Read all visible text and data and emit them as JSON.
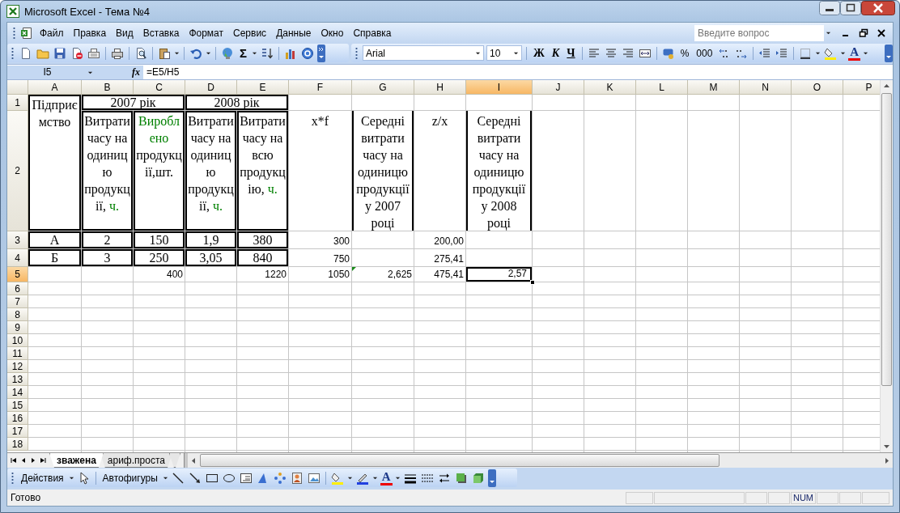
{
  "window": {
    "title": "Microsoft Excel - Тема №4"
  },
  "menu": [
    "Файл",
    "Правка",
    "Вид",
    "Вставка",
    "Формат",
    "Сервис",
    "Данные",
    "Окно",
    "Справка"
  ],
  "help_search": {
    "placeholder": "Введите вопрос"
  },
  "standard_toolbar": {
    "sum": "Σ"
  },
  "formatting_toolbar": {
    "font": "Arial",
    "size": "10",
    "bold": "Ж",
    "italic": "К",
    "underline": "Ч",
    "percent": "%",
    "thousands": "000",
    "font_color": "A"
  },
  "formula_bar": {
    "name_box": "I5",
    "function_label": "fx",
    "formula": "=E5/H5"
  },
  "sheet": {
    "columns": [
      {
        "label": "A",
        "selected": false
      },
      {
        "label": "B",
        "selected": false
      },
      {
        "label": "C",
        "selected": false
      },
      {
        "label": "D",
        "selected": false
      },
      {
        "label": "E",
        "selected": false
      },
      {
        "label": "F",
        "selected": false
      },
      {
        "label": "G",
        "selected": false
      },
      {
        "label": "H",
        "selected": false
      },
      {
        "label": "I",
        "selected": true
      },
      {
        "label": "J",
        "selected": false
      },
      {
        "label": "K",
        "selected": false
      },
      {
        "label": "L",
        "selected": false
      },
      {
        "label": "M",
        "selected": false
      },
      {
        "label": "N",
        "selected": false
      },
      {
        "label": "O",
        "selected": false
      },
      {
        "label": "P",
        "selected": false
      }
    ],
    "rows": [
      {
        "label": "1",
        "selected": false,
        "cells": [
          {
            "text": "Підприємство",
            "selected": false,
            "error_flag": false
          },
          {
            "text": "2007 рік",
            "selected": false,
            "error_flag": false
          },
          {
            "text": "2008 рік",
            "selected": false,
            "error_flag": false
          }
        ]
      },
      {
        "label": "2",
        "selected": false,
        "cells": [
          {
            "parts": [
              {
                "text": "Витрати часу на одиницю продукції,",
                "color": "#000000"
              },
              {
                "text": "ч.",
                "color": "#008000"
              }
            ],
            "selected": false,
            "error_flag": false
          },
          {
            "parts": [
              {
                "text": "Вироблено",
                "color": "#008000"
              },
              {
                "text": "продукції,шт.",
                "color": "#000000"
              }
            ],
            "selected": false,
            "error_flag": false
          },
          {
            "parts": [
              {
                "text": "Витрати часу на одиницю продукції,",
                "color": "#000000"
              },
              {
                "text": "ч.",
                "color": "#008000"
              }
            ],
            "selected": false,
            "error_flag": false
          },
          {
            "parts": [
              {
                "text": "Витрати часу на всю продукцію,",
                "color": "#000000"
              },
              {
                "text": "ч.",
                "color": "#008000"
              }
            ],
            "selected": false,
            "error_flag": false
          },
          {
            "text": "x*f",
            "selected": false,
            "error_flag": false
          },
          {
            "text": "Середні витрати часу на одиницю продукції у 2007 році",
            "selected": false,
            "error_flag": false
          },
          {
            "text": "z/x",
            "selected": false,
            "error_flag": false
          },
          {
            "text": "Середні витрати часу на одиницю продукції у 2008 році",
            "selected": false,
            "error_flag": false
          }
        ]
      },
      {
        "label": "3",
        "selected": false,
        "cells": [
          {
            "text": "А",
            "selected": false,
            "error_flag": false
          },
          {
            "text": "2",
            "selected": false,
            "error_flag": false
          },
          {
            "text": "150",
            "selected": false,
            "error_flag": false
          },
          {
            "text": "1,9",
            "selected": false,
            "error_flag": false
          },
          {
            "text": "380",
            "selected": false,
            "error_flag": false
          },
          {
            "text": "300",
            "selected": false,
            "error_flag": false
          },
          {
            "text": "200,00",
            "selected": false,
            "error_flag": false
          }
        ]
      },
      {
        "label": "4",
        "selected": false,
        "cells": [
          {
            "text": "Б",
            "selected": false,
            "error_flag": false
          },
          {
            "text": "3",
            "selected": false,
            "error_flag": false
          },
          {
            "text": "250",
            "selected": false,
            "error_flag": false
          },
          {
            "text": "3,05",
            "selected": false,
            "error_flag": false
          },
          {
            "text": "840",
            "selected": false,
            "error_flag": false
          },
          {
            "text": "750",
            "selected": false,
            "error_flag": false
          },
          {
            "text": "275,41",
            "selected": false,
            "error_flag": false
          }
        ]
      },
      {
        "label": "5",
        "selected": true,
        "cells": [
          {
            "text": "400",
            "selected": false,
            "error_flag": false
          },
          {
            "text": "1220",
            "selected": false,
            "error_flag": false
          },
          {
            "text": "1050",
            "selected": false,
            "error_flag": false
          },
          {
            "text": "2,625",
            "selected": false,
            "error_flag": true
          },
          {
            "text": "475,41",
            "selected": false,
            "error_flag": false
          },
          {
            "text": "2,57",
            "selected": true,
            "error_flag": false
          }
        ]
      },
      {
        "label": "6",
        "selected": false
      },
      {
        "label": "7",
        "selected": false
      },
      {
        "label": "8",
        "selected": false
      },
      {
        "label": "9",
        "selected": false
      },
      {
        "label": "10",
        "selected": false
      },
      {
        "label": "11",
        "selected": false
      },
      {
        "label": "12",
        "selected": false
      },
      {
        "label": "13",
        "selected": false
      },
      {
        "label": "14",
        "selected": false
      },
      {
        "label": "15",
        "selected": false
      },
      {
        "label": "16",
        "selected": false
      },
      {
        "label": "17",
        "selected": false
      },
      {
        "label": "18",
        "selected": false
      }
    ]
  },
  "sheet_tabs": [
    {
      "label": "зважена",
      "selected": true
    },
    {
      "label": "ариф.проста",
      "selected": false
    }
  ],
  "drawing_toolbar": {
    "actions": "Действия",
    "autoshapes": "Автофигуры",
    "font_color": "A"
  },
  "status_bar": {
    "text": "Готово",
    "indicators": [
      "NUM"
    ]
  }
}
